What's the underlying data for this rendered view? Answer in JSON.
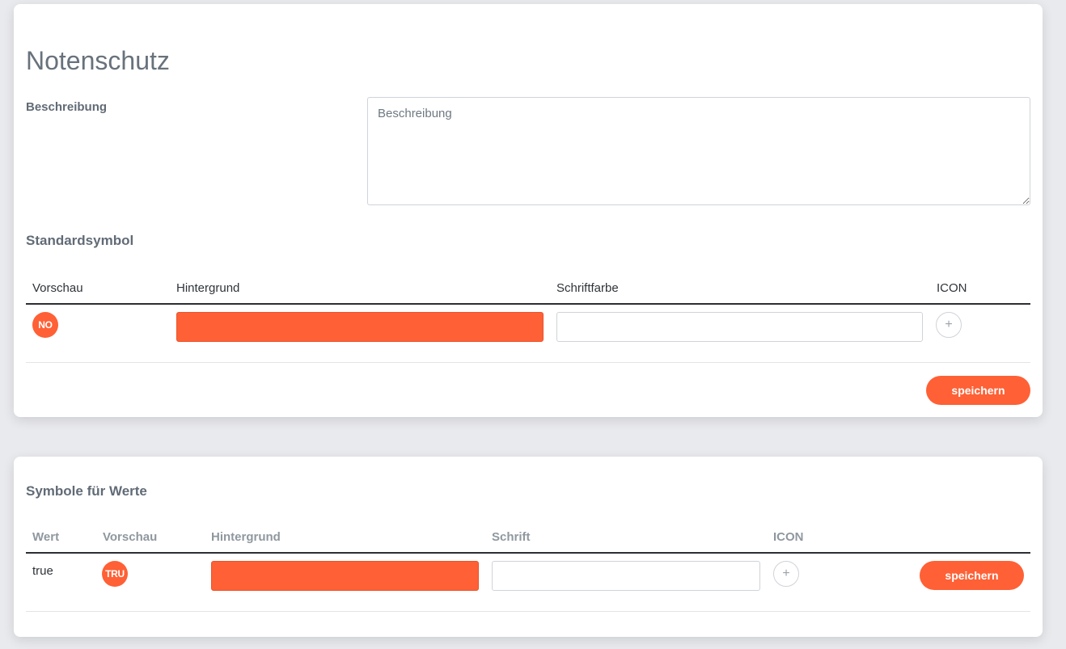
{
  "card1": {
    "title": "Notenschutz",
    "description": {
      "label": "Beschreibung",
      "placeholder": "Beschreibung",
      "value": ""
    },
    "standard_symbol": {
      "title": "Standardsymbol",
      "columns": [
        "Vorschau",
        "Hintergrund",
        "Schriftfarbe",
        "ICON"
      ],
      "row": {
        "preview_text": "NO",
        "background_color": "#ff6035",
        "font_color": "",
        "icon_button": "+"
      }
    },
    "save_label": "speichern"
  },
  "card2": {
    "title": "Symbole für Werte",
    "columns": [
      "Wert",
      "Vorschau",
      "Hintergrund",
      "Schrift",
      "ICON"
    ],
    "rows": [
      {
        "value": "true",
        "preview_text": "TRU",
        "background_color": "#ff6035",
        "font_color": "",
        "icon_button": "+",
        "save_label": "speichern"
      }
    ]
  },
  "colors": {
    "accent": "#ff6035",
    "background": "#e9eaee",
    "card": "#ffffff"
  }
}
